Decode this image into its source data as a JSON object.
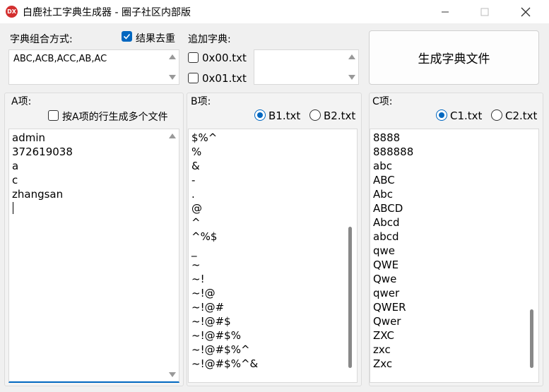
{
  "window": {
    "icon_text": "DX",
    "title": "白鹿社工字典生成器 - 圈子社区内部版"
  },
  "combo": {
    "label": "字典组合方式:",
    "dedup_label": "结果去重",
    "dedup_checked": true,
    "value": "ABC,ACB,ACC,AB,AC"
  },
  "extra": {
    "label": "追加字典:",
    "options": [
      {
        "label": "0x00.txt",
        "checked": false
      },
      {
        "label": "0x01.txt",
        "checked": false
      }
    ]
  },
  "generate_button": "生成字典文件",
  "groupA": {
    "title": "A项:",
    "multi_file_label": "按A项的行生成多个文件",
    "multi_file_checked": false,
    "lines": [
      "admin",
      "372619038",
      "a",
      "c",
      "zhangsan"
    ]
  },
  "groupB": {
    "title": "B项:",
    "radios": [
      {
        "label": "B1.txt",
        "checked": true
      },
      {
        "label": "B2.txt",
        "checked": false
      }
    ],
    "lines": [
      "$%^",
      "%",
      "&",
      "-",
      ".",
      "@",
      "^",
      "^%$",
      "_",
      "~",
      "~!",
      "~!@",
      "~!@#",
      "~!@#$",
      "~!@#$%",
      "~!@#$%^",
      "~!@#$%^&"
    ]
  },
  "groupC": {
    "title": "C项:",
    "radios": [
      {
        "label": "C1.txt",
        "checked": true
      },
      {
        "label": "C2.txt",
        "checked": false
      }
    ],
    "lines": [
      "8888",
      "888888",
      "abc",
      "ABC",
      "Abc",
      "ABCD",
      "Abcd",
      "abcd",
      "qwe",
      "QWE",
      "Qwe",
      "qwer",
      "QWER",
      "Qwer",
      "ZXC",
      "zxc",
      "Zxc"
    ]
  }
}
